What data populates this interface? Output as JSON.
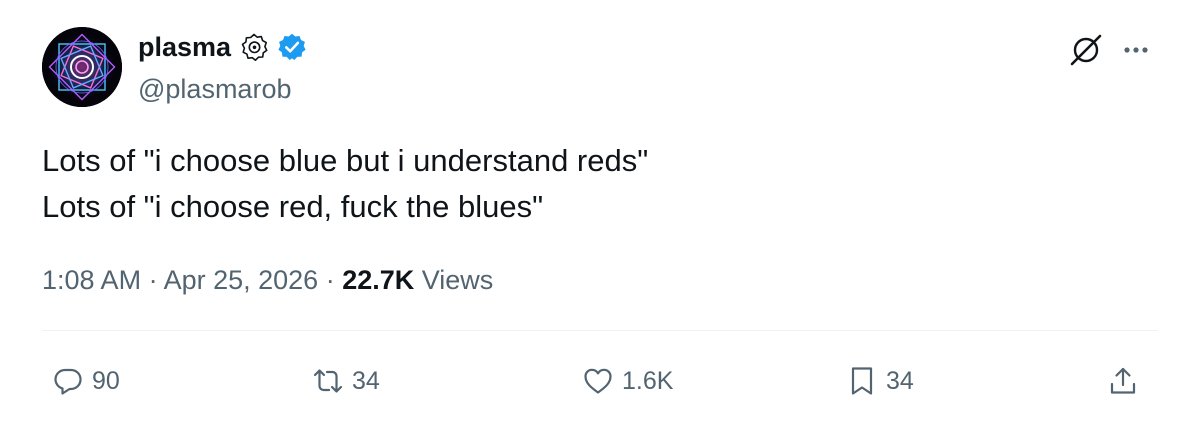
{
  "author": {
    "display_name": "plasma",
    "handle": "@plasmarob",
    "verified": true,
    "verified_color": "#1d9bf0"
  },
  "tweet": {
    "lines": [
      "Lots of \"i choose blue but i understand reds\"",
      "Lots of \"i choose red, fuck the blues\""
    ],
    "time": "1:08 AM",
    "date": "Apr 25, 2026",
    "separator": " · ",
    "views_count": "22.7K",
    "views_label": " Views"
  },
  "actions": {
    "reply_count": "90",
    "retweet_count": "34",
    "like_count": "1.6K",
    "bookmark_count": "34"
  },
  "icons": {
    "affiliation": "affiliation-badge-icon",
    "verified": "verified-badge-icon",
    "grok": "grok-icon",
    "more": "more-icon",
    "reply": "reply-icon",
    "retweet": "retweet-icon",
    "like": "heart-icon",
    "bookmark": "bookmark-icon",
    "share": "share-icon"
  },
  "colors": {
    "text_primary": "#0f1419",
    "text_secondary": "#536471",
    "divider": "#eff3f4"
  }
}
